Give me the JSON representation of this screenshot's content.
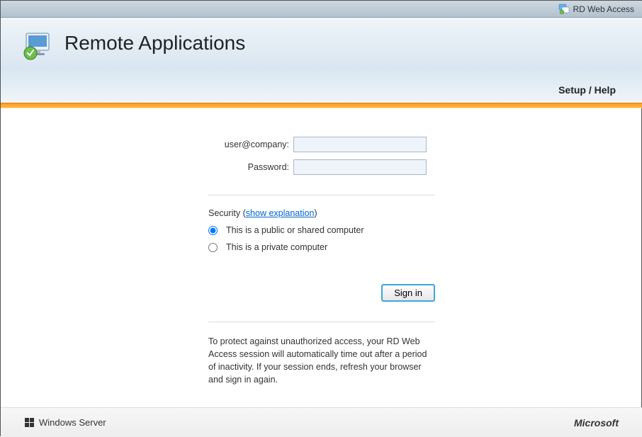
{
  "topbar": {
    "label": "RD Web Access"
  },
  "header": {
    "title": "Remote Applications",
    "help": "Setup / Help"
  },
  "form": {
    "user_label": "user@company:",
    "password_label": "Password:",
    "user_value": "",
    "password_value": ""
  },
  "security": {
    "label_prefix": "Security (",
    "link": "show explanation",
    "label_suffix": ")",
    "option_public": "This is a public or shared computer",
    "option_private": "This is a private computer"
  },
  "signin_label": "Sign in",
  "notice": "To protect against unauthorized access, your RD Web Access session will automatically time out after a period of inactivity. If your session ends, refresh your browser and sign in again.",
  "footer": {
    "left": "Windows Server",
    "right": "Microsoft"
  }
}
